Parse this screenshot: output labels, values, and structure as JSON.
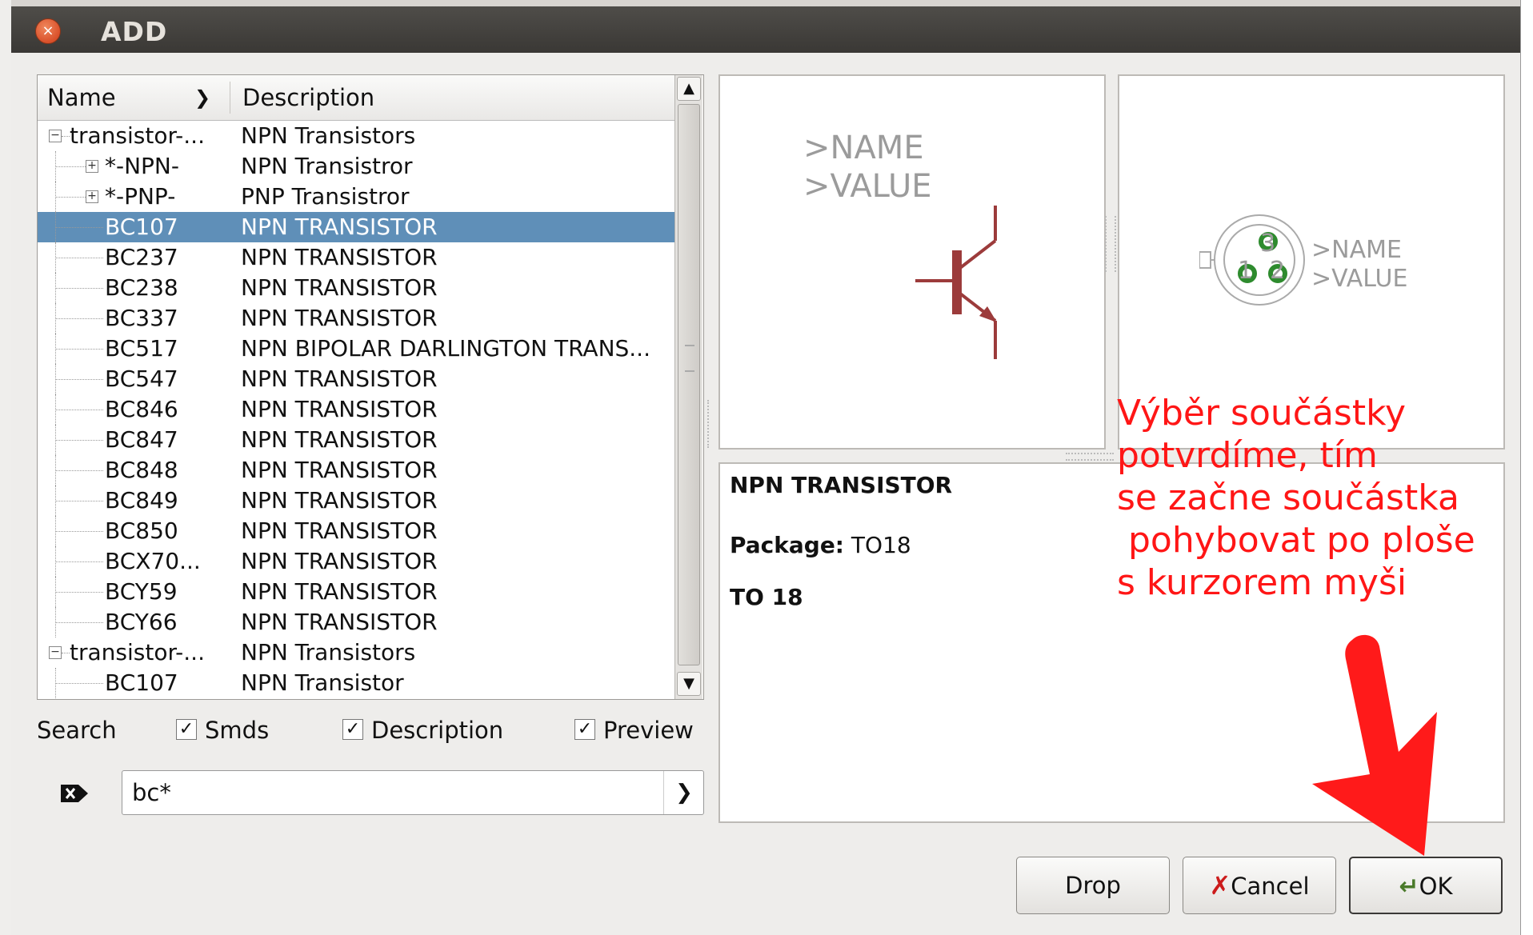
{
  "window": {
    "title": "ADD",
    "close_glyph": "×"
  },
  "tree": {
    "columns": {
      "name": "Name",
      "description": "Description"
    },
    "rows": [
      {
        "name": "transistor-...",
        "description": "NPN Transistors",
        "level": 0,
        "expander": "minus"
      },
      {
        "name": "*-NPN-",
        "description": "NPN Transistror",
        "level": 1,
        "expander": "plus"
      },
      {
        "name": "*-PNP-",
        "description": "PNP Transistror",
        "level": 1,
        "expander": "plus"
      },
      {
        "name": "BC107",
        "description": "NPN TRANSISTOR",
        "level": 1,
        "selected": true
      },
      {
        "name": "BC237",
        "description": "NPN TRANSISTOR",
        "level": 1
      },
      {
        "name": "BC238",
        "description": "NPN TRANSISTOR",
        "level": 1
      },
      {
        "name": "BC337",
        "description": "NPN TRANSISTOR",
        "level": 1
      },
      {
        "name": "BC517",
        "description": "NPN BIPOLAR DARLINGTON TRANS...",
        "level": 1
      },
      {
        "name": "BC547",
        "description": "NPN TRANSISTOR",
        "level": 1
      },
      {
        "name": "BC846",
        "description": "NPN TRANSISTOR",
        "level": 1
      },
      {
        "name": "BC847",
        "description": "NPN TRANSISTOR",
        "level": 1
      },
      {
        "name": "BC848",
        "description": "NPN TRANSISTOR",
        "level": 1
      },
      {
        "name": "BC849",
        "description": "NPN TRANSISTOR",
        "level": 1
      },
      {
        "name": "BC850",
        "description": "NPN TRANSISTOR",
        "level": 1
      },
      {
        "name": "BCX70...",
        "description": "NPN TRANSISTOR",
        "level": 1
      },
      {
        "name": "BCY59",
        "description": "NPN TRANSISTOR",
        "level": 1
      },
      {
        "name": "BCY66",
        "description": "NPN TRANSISTOR",
        "level": 1
      },
      {
        "name": "transistor-...",
        "description": "NPN Transistors",
        "level": 0,
        "expander": "minus"
      },
      {
        "name": "BC107",
        "description": "NPN Transistor",
        "level": 1
      }
    ]
  },
  "options": {
    "search_label": "Search",
    "smds": {
      "label": "Smds",
      "checked": true
    },
    "description": {
      "label": "Description",
      "checked": true
    },
    "preview": {
      "label": "Preview",
      "checked": true
    }
  },
  "search": {
    "value": "bc*",
    "clear_icon": "clear-field-icon"
  },
  "symbol_preview": {
    "name": ">NAME",
    "value": ">VALUE"
  },
  "package_preview": {
    "name": ">NAME",
    "value": ">VALUE",
    "pin3": "3",
    "pin1": "1",
    "pin2": "2"
  },
  "info": {
    "title": "NPN TRANSISTOR",
    "package_label": "Package:",
    "package_value": "TO18",
    "package_desc": "TO 18"
  },
  "annotation": {
    "text": "Výběr součástky\npotvrdíme, tím\nse začne součástka\n pohybovat po ploše\ns kurzorem myši",
    "color": "#ff1616"
  },
  "buttons": {
    "drop": "Drop",
    "cancel": "Cancel",
    "ok": "OK"
  },
  "colors": {
    "selection": "#5f8fb8",
    "symbol": "#9c3b3b",
    "pad": "#2e8b2e"
  }
}
